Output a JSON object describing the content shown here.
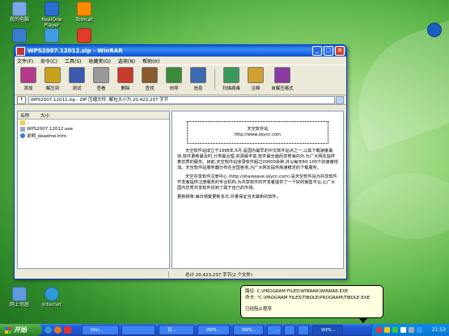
{
  "desktop": {
    "icons": [
      {
        "label": "我的电脑",
        "color": "#7aa7e8"
      },
      {
        "label": "RealOne Player",
        "color": "#2b6fd1"
      },
      {
        "label": "Tomcat",
        "color": "#ff8a00"
      },
      {
        "label": "",
        "color": "#3c7ccc"
      },
      {
        "label": "",
        "color": "#3f9fe0"
      },
      {
        "label": "",
        "color": "#e23b2e"
      },
      {
        "label": "网上邻居",
        "color": "#5f9ae0"
      },
      {
        "label": "Internet",
        "color": "#2f9ad8"
      }
    ]
  },
  "window": {
    "title": "WPS2007.12012.zip - WinRAR",
    "menu": [
      "文件(F)",
      "命令(C)",
      "工具(S)",
      "收藏夹(O)",
      "选项(N)",
      "帮助(H)"
    ],
    "toolbar": [
      {
        "label": "添加",
        "color": "#b33a8a"
      },
      {
        "label": "解压到",
        "color": "#c9a11a"
      },
      {
        "label": "测试",
        "color": "#3a5ab0"
      },
      {
        "label": "查看",
        "color": "#999999"
      },
      {
        "label": "删除",
        "color": "#c63a2a"
      },
      {
        "label": "查找",
        "color": "#8a5a2a"
      },
      {
        "label": "向导",
        "color": "#3a8a3a"
      },
      {
        "label": "信息",
        "color": "#3a6ab0"
      },
      {
        "label": "扫描病毒",
        "color": "#3a9a5a"
      },
      {
        "label": "注释",
        "color": "#d0a030"
      },
      {
        "label": "自解压格式",
        "color": "#8a3aa0"
      }
    ],
    "address": "WPS2007.12012.zip - ZIP 压缩文件, 解包大小为 20,423,237 字节",
    "list_header": {
      "name": "名称",
      "size": "大小"
    },
    "files": [
      {
        "name": "..",
        "icon": "folder"
      },
      {
        "name": "WPS2007.12012.exe",
        "icon": "exe"
      },
      {
        "name": "说明_deadme.htm",
        "icon": "htm"
      }
    ],
    "comment": {
      "site_name": "天空软件站",
      "site_url": "http://www.skycn.com",
      "para1": "天空软件站成立于1998年,5月,是国内最早的中文软件站点之一,以其下载速度最快,软件更新最及时,分类最合理,资源最丰富,软件最全面而享誉海内外,为广大网友提供着优质的服务。目前,天空软件站收录软件超过20000余种,并以每天60-100个的速度增加。天空软件站服务器分布在全国各地,为广大网友提供高速稳定的下载服务。",
      "para2": "天空共享软件注册中心 (http://sharesave.skycn.com) 是天空软件站为共享软件开发者提供注册服务的专业机构,为共享软件的开发者提供了一个好的销售平台,让广大国内优秀共享软件找到了属于自己的市场。",
      "footer": "更新频率:每日频繁更新多次,尽量保证当天最新的软件。"
    },
    "status_left": "",
    "status_right": "总计 20,423,237 字节(2 个文件)"
  },
  "balloon": {
    "line1": "路径: C:\\PROGRAM FILES\\WINRAR\\WINRAR.EXE",
    "line2": "命令: \"C:\\PROGRAM FILES\\TIBOLE\\PROGRAM\\TIBOLE.EXE",
    "line3": "已经阻止程序"
  },
  "taskbar": {
    "start": "开始",
    "buttons": [
      "Win...",
      "",
      "百...",
      "WPS...",
      "WPS...",
      "...",
      "",
      "",
      "WPS..."
    ],
    "clock": "21:53"
  }
}
